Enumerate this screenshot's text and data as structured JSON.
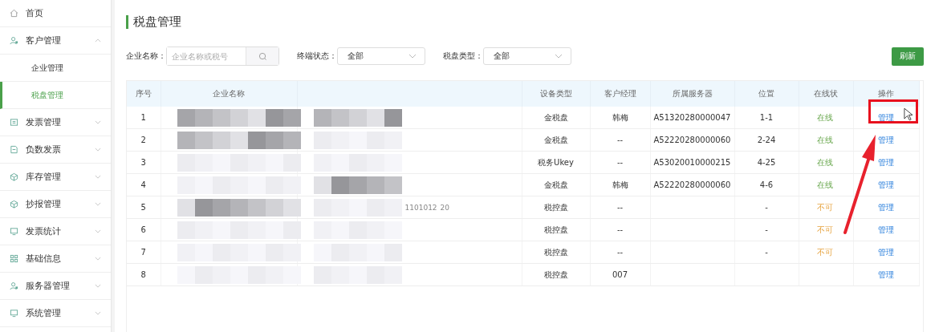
{
  "sidebar": {
    "items": [
      {
        "label": "首页"
      },
      {
        "label": "客户管理",
        "expanded": true,
        "children": [
          {
            "label": "企业管理",
            "selected": false
          },
          {
            "label": "税盘管理",
            "selected": true
          }
        ]
      },
      {
        "label": "发票管理",
        "expanded": false
      },
      {
        "label": "负数发票",
        "expanded": false
      },
      {
        "label": "库存管理",
        "expanded": false
      },
      {
        "label": "抄报管理",
        "expanded": false
      },
      {
        "label": "发票统计",
        "expanded": false
      },
      {
        "label": "基础信息",
        "expanded": false
      },
      {
        "label": "服务器管理",
        "expanded": false
      },
      {
        "label": "系统管理",
        "expanded": false
      }
    ]
  },
  "page": {
    "title": "税盘管理"
  },
  "filters": {
    "company": {
      "label": "企业名称：",
      "placeholder": "企业名称或税号"
    },
    "selects": [
      {
        "label": "终端状态：",
        "value": "全部"
      },
      {
        "label": "税盘类型：",
        "value": "全部"
      }
    ],
    "refresh": "刷新"
  },
  "table": {
    "columns": [
      "序号",
      "企业名称",
      "",
      "设备类型",
      "客户经理",
      "所属服务器",
      "位置",
      "在线状",
      "操作"
    ],
    "rows": [
      {
        "index": "1",
        "fragments": [],
        "device": "金税盘",
        "manager": "韩梅",
        "server": "A51320280000047",
        "position": "1-1",
        "status": "在线",
        "kind": "online",
        "action": "管理"
      },
      {
        "index": "2",
        "fragments": [],
        "device": "金税盘",
        "manager": "--",
        "server": "A52220280000060",
        "position": "2-24",
        "status": "在线",
        "kind": "online",
        "action": "管理"
      },
      {
        "index": "3",
        "fragments": [],
        "device": "税务Ukey",
        "manager": "--",
        "server": "A53020010000215",
        "position": "4-25",
        "status": "在线",
        "kind": "online",
        "action": "管理"
      },
      {
        "index": "4",
        "fragments": [],
        "device": "金税盘",
        "manager": "韩梅",
        "server": "A52220280000060",
        "position": "4-6",
        "status": "在线",
        "kind": "online",
        "action": "管理"
      },
      {
        "index": "5",
        "fragments": [
          "1101012",
          "20"
        ],
        "device": "税控盘",
        "manager": "--",
        "server": "",
        "position": "-",
        "status": "不可",
        "kind": "unavailable",
        "action": "管理"
      },
      {
        "index": "6",
        "fragments": [],
        "device": "税控盘",
        "manager": "--",
        "server": "",
        "position": "-",
        "status": "不可",
        "kind": "unavailable",
        "action": "管理"
      },
      {
        "index": "7",
        "fragments": [],
        "device": "税控盘",
        "manager": "--",
        "server": "",
        "position": "-",
        "status": "不可",
        "kind": "unavailable",
        "action": "管理"
      },
      {
        "index": "8",
        "fragments": [],
        "device": "税控盘",
        "manager": "007",
        "server": "",
        "position": "",
        "status": "",
        "action": "管理"
      }
    ]
  }
}
